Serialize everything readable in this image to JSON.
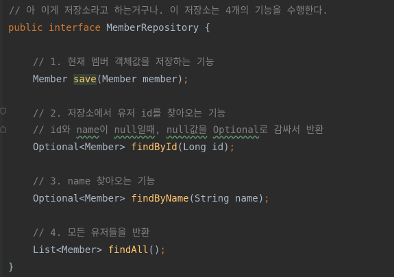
{
  "editor": {
    "lines": {
      "l1": "// 아 이게 저장소라고 하는거구나. 이 저장소는 4개의 기능을 수행한다.",
      "l2": {
        "kw1": "public",
        "kw2": "interface",
        "name": "MemberRepository",
        "brace": "{"
      },
      "l4": "// 1. 현재 멤버 객체값을 저장하는 기능",
      "l5": {
        "type": "Member",
        "method": "save",
        "params": "(Member member)",
        "semi": ";"
      },
      "l7": "// 2. 저장소에서 유저 id를 찾아오는 기능",
      "l8": {
        "a": "// id와 ",
        "b": "name",
        "c": "이 ",
        "d": "null",
        "e": "일때",
        "f": ", ",
        "g": "null",
        "h": "값을",
        "i": " ",
        "j": "Optional",
        "k": "로 감싸서 반환"
      },
      "l9": {
        "type": "Optional<Member>",
        "method": "findById",
        "params": "(Long id)",
        "semi": ";"
      },
      "l11": "// 3. name 찾아오는 기능",
      "l12": {
        "type": "Optional<Member>",
        "method": "findByName",
        "params": "(String name)",
        "semi": ";"
      },
      "l14": "// 4. 모든 유저들을 반환",
      "l15": {
        "type": "List<Member>",
        "method": "findAll",
        "params": "()",
        "semi": ";"
      },
      "l16": "}"
    }
  }
}
